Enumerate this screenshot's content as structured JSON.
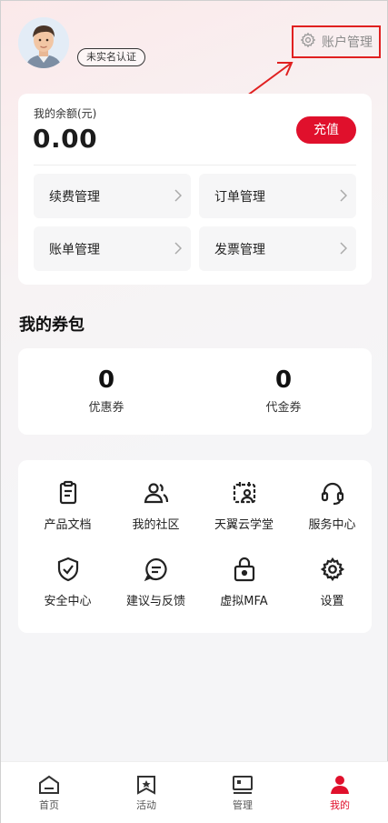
{
  "header": {
    "verify_badge": "未实名认证",
    "account_mgmt_label": "账户管理"
  },
  "balance": {
    "label": "我的余额(元)",
    "value": "0.00",
    "recharge_label": "充值",
    "items": [
      "续费管理",
      "订单管理",
      "账单管理",
      "发票管理"
    ]
  },
  "coupons": {
    "title": "我的券包",
    "items": [
      {
        "count": "0",
        "label": "优惠券"
      },
      {
        "count": "0",
        "label": "代金券"
      }
    ]
  },
  "services": [
    {
      "label": "产品文档",
      "icon": "document-icon"
    },
    {
      "label": "我的社区",
      "icon": "community-icon"
    },
    {
      "label": "天翼云学堂",
      "icon": "classroom-icon"
    },
    {
      "label": "服务中心",
      "icon": "headset-icon"
    },
    {
      "label": "安全中心",
      "icon": "shield-icon"
    },
    {
      "label": "建议与反馈",
      "icon": "feedback-icon"
    },
    {
      "label": "虚拟MFA",
      "icon": "lock-icon"
    },
    {
      "label": "设置",
      "icon": "gear-icon"
    }
  ],
  "tabbar": [
    {
      "label": "首页",
      "icon": "home-icon"
    },
    {
      "label": "活动",
      "icon": "activity-icon"
    },
    {
      "label": "管理",
      "icon": "manage-icon"
    },
    {
      "label": "我的",
      "icon": "profile-icon",
      "active": true
    }
  ],
  "colors": {
    "accent": "#e0102c",
    "annotation": "#e02020"
  }
}
